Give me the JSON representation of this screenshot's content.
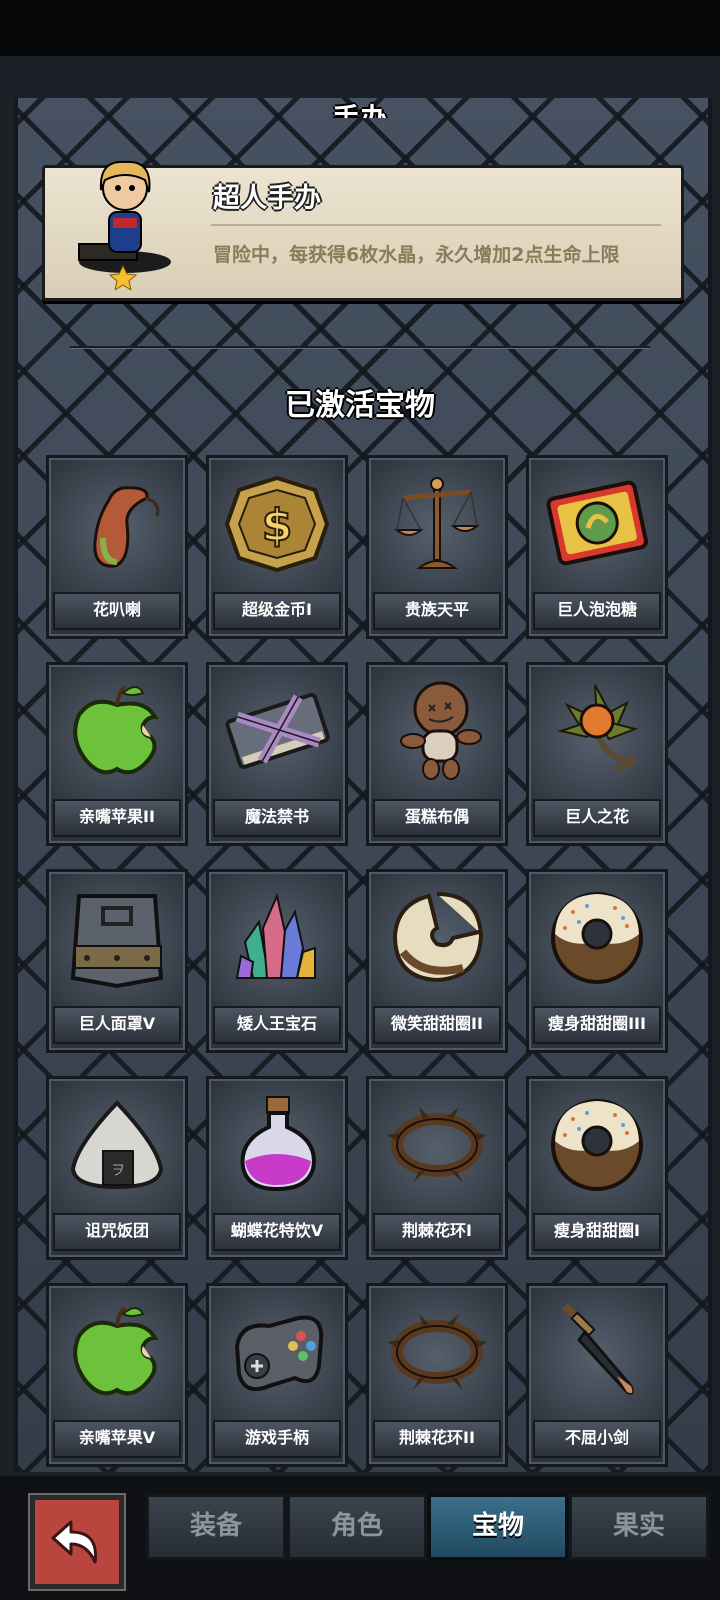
{
  "header": {
    "partial_title": "手办",
    "section_title": "已激活宝物"
  },
  "card": {
    "title": "超人手办",
    "description": "冒险中，每获得6枚水晶，永久增加2点生命上限"
  },
  "items": [
    {
      "label": "花叭喇",
      "icon": "pitcher-plant-icon"
    },
    {
      "label": "超级金币I",
      "icon": "gold-coin-icon"
    },
    {
      "label": "贵族天平",
      "icon": "balance-scale-icon"
    },
    {
      "label": "巨人泡泡糖",
      "icon": "bubble-gum-icon"
    },
    {
      "label": "亲嘴苹果II",
      "icon": "green-apple-icon"
    },
    {
      "label": "魔法禁书",
      "icon": "forbidden-book-icon"
    },
    {
      "label": "蛋糕布偶",
      "icon": "voodoo-doll-icon"
    },
    {
      "label": "巨人之花",
      "icon": "giant-flower-icon"
    },
    {
      "label": "巨人面罩V",
      "icon": "iron-mask-icon"
    },
    {
      "label": "矮人王宝石",
      "icon": "crystals-icon"
    },
    {
      "label": "微笑甜甜圈II",
      "icon": "smile-donut-icon"
    },
    {
      "label": "瘦身甜甜圈III",
      "icon": "donut-icon"
    },
    {
      "label": "诅咒饭团",
      "icon": "rice-ball-icon"
    },
    {
      "label": "蝴蝶花特饮V",
      "icon": "potion-icon"
    },
    {
      "label": "荆棘花环I",
      "icon": "thorn-wreath-icon"
    },
    {
      "label": "瘦身甜甜圈I",
      "icon": "donut-icon"
    },
    {
      "label": "亲嘴苹果V",
      "icon": "green-apple-icon"
    },
    {
      "label": "游戏手柄",
      "icon": "gamepad-icon"
    },
    {
      "label": "荆棘花环II",
      "icon": "thorn-wreath-icon"
    },
    {
      "label": "不屈小剑",
      "icon": "short-sword-icon"
    }
  ],
  "tabs": [
    {
      "label": "装备",
      "active": false
    },
    {
      "label": "角色",
      "active": false
    },
    {
      "label": "宝物",
      "active": true
    },
    {
      "label": "果实",
      "active": false
    }
  ],
  "colors": {
    "tab_active": "#2f5f7a",
    "back_button": "#b8463f",
    "card_bg": "#e4dcc6"
  }
}
